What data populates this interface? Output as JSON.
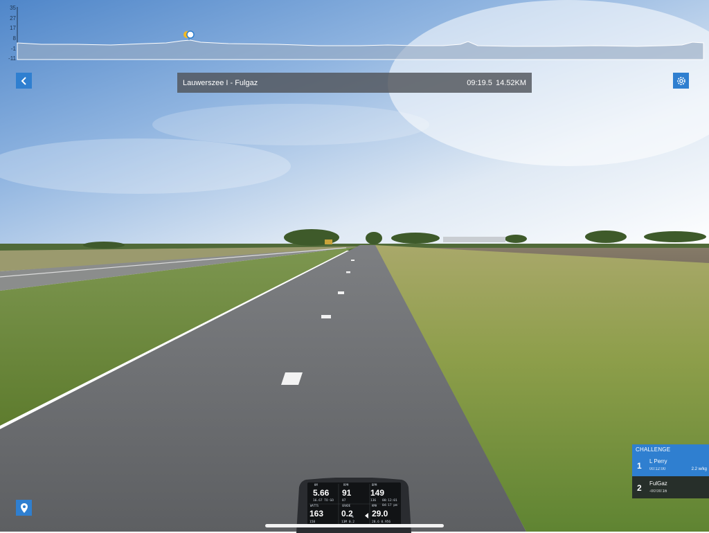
{
  "elevation": {
    "y_ticks": [
      "35",
      "27",
      "17",
      "8",
      "-1",
      "-11"
    ]
  },
  "header": {
    "route_name": "Lauwerszee I - Fulgaz",
    "time": "09:19.5",
    "distance": "14.52KM",
    "back_icon": "chevron-left-icon",
    "settings_icon": "gear-icon"
  },
  "challenge": {
    "title": "CHALLENGE",
    "entries": [
      {
        "rank": "1",
        "name": "L Perry",
        "time": "00:12:00",
        "wkg": "2.2 w/kg"
      },
      {
        "rank": "2",
        "name": "FulGaz",
        "time": "-00:00:16",
        "wkg": ""
      }
    ]
  },
  "computer": {
    "km_label": "KM",
    "km_value": "5.66",
    "km_sub": "16.67 TO GO",
    "rpm_label": "RPM",
    "rpm_value": "91",
    "rpm_sub": "87",
    "bpm_label": "BPM",
    "bpm_value": "149",
    "bpm_sub1": "136",
    "bpm_sub2": "00:12:01",
    "watts_label": "WATTS",
    "watts_value": "163",
    "watts_sub": "158",
    "grade_label": "GRADE",
    "grade_value": "0.2",
    "grade_unit": "%",
    "grade_sub": "13M 0.2",
    "kmh_label": "KMH",
    "kmh_value": "29.0",
    "kmh_sub1": "04:17 pm",
    "kmh_sub2": "28.6 0.956"
  },
  "map_icon": "map-pin-icon",
  "colors": {
    "accent": "#2f7fd0",
    "title_bar": "#50545a"
  }
}
